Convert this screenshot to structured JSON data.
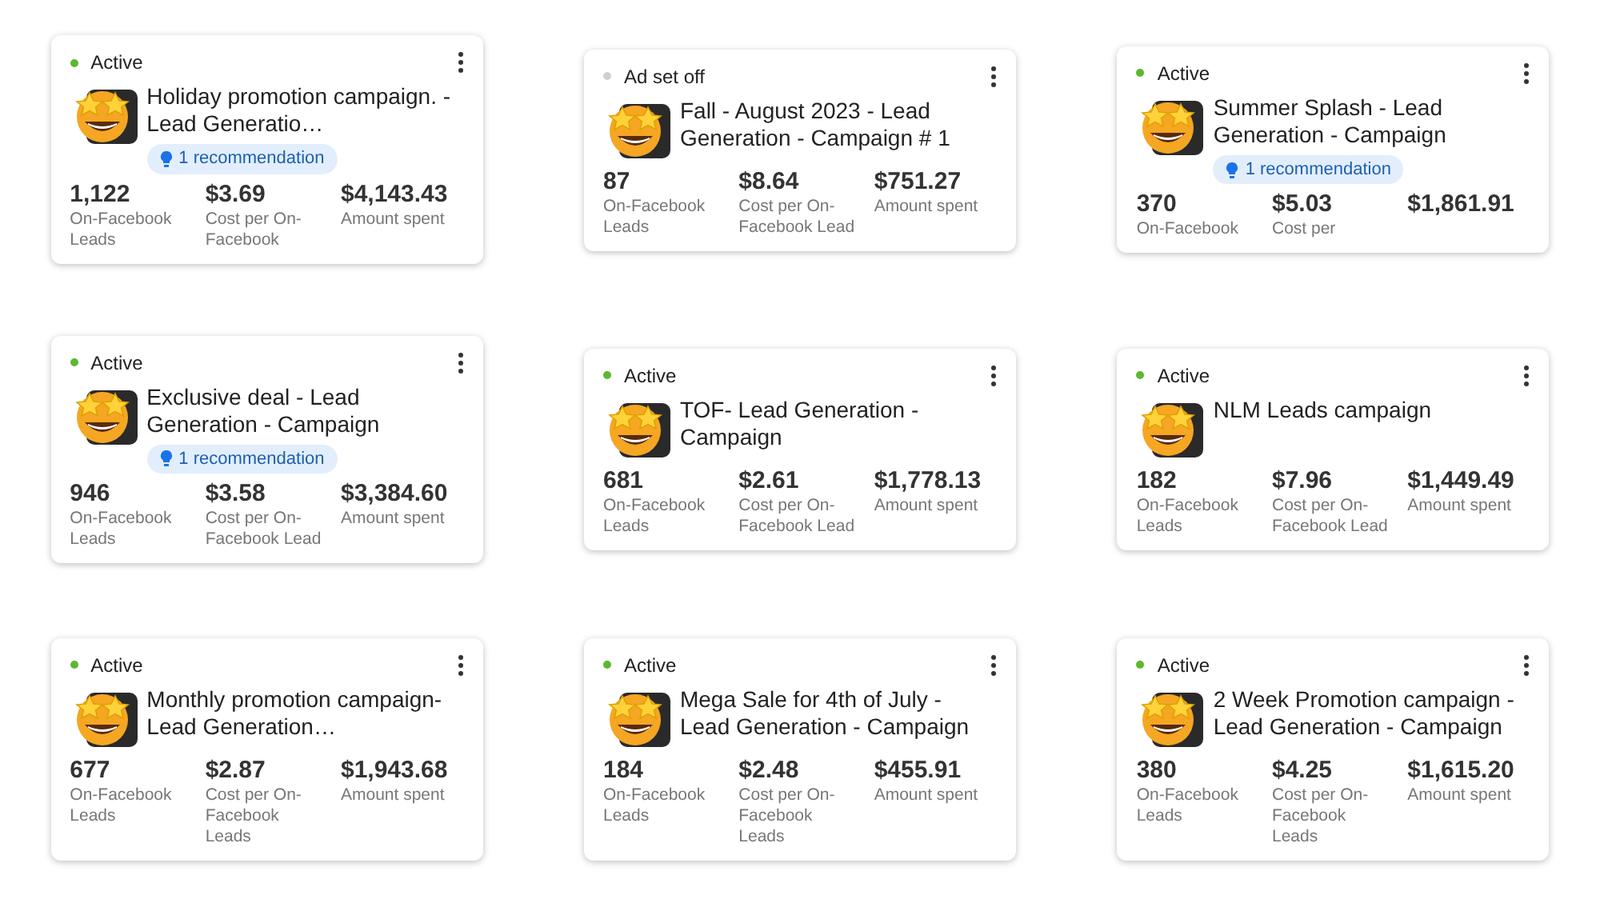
{
  "cards": [
    {
      "status": {
        "kind": "active",
        "label": "Active"
      },
      "title": "Holiday promotion campaign. - Lead Generatio…",
      "recommendation": "1 recommendation",
      "metrics": [
        {
          "value": "1,122",
          "label": "On-Facebook Leads"
        },
        {
          "value": "$3.69",
          "label": "Cost per On-Facebook"
        },
        {
          "value": "$4,143.43",
          "label": "Amount spent"
        }
      ]
    },
    {
      "status": {
        "kind": "off",
        "label": "Ad set off"
      },
      "title": "Fall - August 2023 - Lead Generation - Campaign # 1",
      "metrics": [
        {
          "value": "87",
          "label": "On-Facebook Leads"
        },
        {
          "value": "$8.64",
          "label": "Cost per On-Facebook Lead"
        },
        {
          "value": "$751.27",
          "label": "Amount spent"
        }
      ]
    },
    {
      "status": {
        "kind": "active",
        "label": "Active"
      },
      "title": "Summer Splash - Lead Generation - Campaign",
      "recommendation": "1 recommendation",
      "metrics": [
        {
          "value": "370",
          "label": "On-Facebook"
        },
        {
          "value": "$5.03",
          "label": "Cost per"
        },
        {
          "value": "$1,861.91"
        }
      ]
    },
    {
      "status": {
        "kind": "active",
        "label": "Active"
      },
      "title": "Exclusive deal - Lead Generation - Campaign",
      "recommendation": "1 recommendation",
      "metrics": [
        {
          "value": "946",
          "label": "On-Facebook Leads"
        },
        {
          "value": "$3.58",
          "label": "Cost per On-Facebook Lead"
        },
        {
          "value": "$3,384.60",
          "label": "Amount spent"
        }
      ]
    },
    {
      "status": {
        "kind": "active",
        "label": "Active"
      },
      "title": "TOF- Lead Generation - Campaign",
      "metrics": [
        {
          "value": "681",
          "label": "On-Facebook Leads"
        },
        {
          "value": "$2.61",
          "label": "Cost per On-Facebook Lead"
        },
        {
          "value": "$1,778.13",
          "label": "Amount spent"
        }
      ]
    },
    {
      "status": {
        "kind": "active",
        "label": "Active"
      },
      "title": "NLM Leads campaign",
      "metrics": [
        {
          "value": "182",
          "label": "On-Facebook Leads"
        },
        {
          "value": "$7.96",
          "label": "Cost per On-Facebook Lead"
        },
        {
          "value": "$1,449.49",
          "label": "Amount spent"
        }
      ]
    },
    {
      "status": {
        "kind": "active",
        "label": "Active"
      },
      "title": "Monthly promotion campaign- Lead Generation…",
      "metrics": [
        {
          "value": "677",
          "label": "On-Facebook Leads"
        },
        {
          "value": "$2.87",
          "label": "Cost per On-Facebook Leads"
        },
        {
          "value": "$1,943.68",
          "label": "Amount spent"
        }
      ]
    },
    {
      "status": {
        "kind": "active",
        "label": "Active"
      },
      "title": "Mega Sale for 4th of July - Lead Generation - Campaign",
      "metrics": [
        {
          "value": "184",
          "label": "On-Facebook Leads"
        },
        {
          "value": "$2.48",
          "label": "Cost per On-Facebook Leads"
        },
        {
          "value": "$455.91",
          "label": "Amount spent"
        }
      ]
    },
    {
      "status": {
        "kind": "active",
        "label": "Active"
      },
      "title": "2 Week Promotion campaign -Lead Generation - Campaign",
      "metrics": [
        {
          "value": "380",
          "label": "On-Facebook Leads"
        },
        {
          "value": "$4.25",
          "label": "Cost per On-Facebook Leads"
        },
        {
          "value": "$1,615.20",
          "label": "Amount spent"
        }
      ]
    }
  ]
}
